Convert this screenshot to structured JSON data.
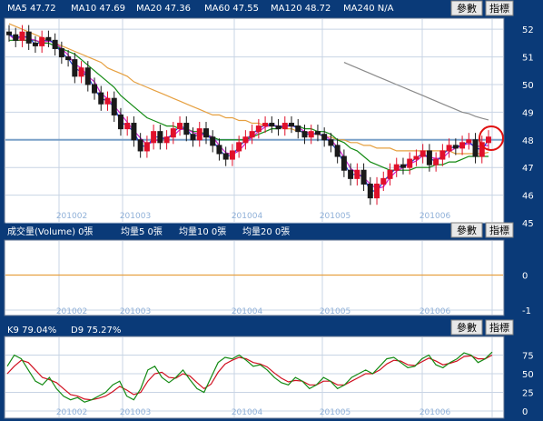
{
  "colors": {
    "background": "#0a3a78",
    "plot_bg": "#ffffff",
    "grid": "#c8d4e4",
    "border": "#5a6e8c",
    "up_candle": "#e0102a",
    "down_candle": "#1a1a1a",
    "ma5": "#1a3bd6",
    "ma10": "#d020d0",
    "ma20": "#138a13",
    "ma60": "#e6a040",
    "ma120": "#8a8a8a",
    "k_line": "#138a13",
    "d_line": "#d01020",
    "volume_zero_line": "#e6a040",
    "price_line": "#7aa0c8",
    "highlight_circle": "#e01010"
  },
  "buttons": {
    "query_label": "參數",
    "indicator_label": "指標"
  },
  "panels": {
    "price": {
      "header": [
        "MA5 47.72",
        "MA10 47.69",
        "MA20 47.36",
        "MA60 47.55",
        "MA120 48.72",
        "MA240 N/A"
      ]
    },
    "volume": {
      "header": [
        "成交量(Volume) 0張",
        "均量5 0張",
        "均量10 0張",
        "均量20 0張"
      ]
    },
    "kd": {
      "header": [
        "K9 79.04%",
        "D9 75.27%"
      ]
    }
  },
  "chart_data": [
    {
      "type": "line",
      "panel": "price",
      "x_labels": [
        "201002",
        "201003",
        "201004",
        "201005",
        "201006"
      ],
      "y_ticks": [
        "45",
        "46",
        "47",
        "48",
        "49",
        "50",
        "51",
        "52"
      ],
      "ylim": [
        45,
        52.4
      ],
      "grid": true,
      "current_price": 48,
      "series": [
        {
          "name": "MA5",
          "value": 47.72
        },
        {
          "name": "MA10",
          "value": 47.69
        },
        {
          "name": "MA20",
          "value": 47.36
        },
        {
          "name": "MA60",
          "value": 47.55
        },
        {
          "name": "MA120",
          "value": 48.72
        }
      ],
      "close": [
        51.8,
        51.6,
        51.9,
        51.5,
        51.4,
        51.7,
        51.6,
        51.3,
        51.0,
        50.9,
        50.3,
        50.6,
        50.0,
        49.7,
        49.3,
        49.5,
        48.9,
        48.4,
        48.6,
        48.0,
        47.6,
        47.9,
        48.3,
        47.9,
        48.1,
        48.4,
        48.6,
        48.2,
        48.0,
        48.4,
        48.1,
        47.8,
        47.5,
        47.3,
        47.6,
        47.9,
        48.1,
        48.3,
        48.5,
        48.6,
        48.5,
        48.4,
        48.6,
        48.5,
        48.3,
        48.1,
        48.3,
        48.2,
        48.0,
        47.8,
        47.4,
        46.9,
        46.6,
        46.9,
        46.4,
        45.9,
        46.4,
        46.6,
        46.9,
        47.1,
        47.0,
        47.3,
        47.4,
        47.6,
        47.1,
        47.3,
        47.6,
        47.8,
        47.7,
        47.9,
        48.0,
        47.4,
        47.9,
        48.1
      ],
      "ma20": [
        51.6,
        51.6,
        51.6,
        51.6,
        51.6,
        51.5,
        51.5,
        51.4,
        51.3,
        51.2,
        51.1,
        50.9,
        50.7,
        50.5,
        50.3,
        50.1,
        49.9,
        49.6,
        49.4,
        49.2,
        49.0,
        48.8,
        48.7,
        48.6,
        48.5,
        48.5,
        48.4,
        48.4,
        48.3,
        48.3,
        48.2,
        48.1,
        48.0,
        48.0,
        48.0,
        48.0,
        48.0,
        48.1,
        48.2,
        48.3,
        48.4,
        48.4,
        48.5,
        48.5,
        48.5,
        48.4,
        48.4,
        48.3,
        48.3,
        48.2,
        48.0,
        47.9,
        47.7,
        47.6,
        47.4,
        47.2,
        47.1,
        47.0,
        46.9,
        46.9,
        46.9,
        46.9,
        47.0,
        47.0,
        47.0,
        47.1,
        47.1,
        47.2,
        47.2,
        47.3,
        47.4,
        47.4,
        47.4,
        47.4
      ],
      "ma60": [
        52.2,
        52.1,
        52.0,
        51.9,
        51.8,
        51.7,
        51.6,
        51.5,
        51.4,
        51.3,
        51.2,
        51.1,
        51.0,
        50.9,
        50.8,
        50.6,
        50.5,
        50.4,
        50.3,
        50.1,
        50.0,
        49.9,
        49.8,
        49.7,
        49.6,
        49.5,
        49.4,
        49.3,
        49.2,
        49.1,
        49.0,
        48.9,
        48.9,
        48.8,
        48.8,
        48.7,
        48.7,
        48.6,
        48.6,
        48.5,
        48.5,
        48.5,
        48.4,
        48.4,
        48.3,
        48.3,
        48.2,
        48.2,
        48.1,
        48.1,
        48.0,
        48.0,
        47.9,
        47.9,
        47.8,
        47.8,
        47.7,
        47.7,
        47.7,
        47.6,
        47.6,
        47.6,
        47.6,
        47.6,
        47.6,
        47.6,
        47.6,
        47.6,
        47.5,
        47.5,
        47.5,
        47.5,
        47.5,
        47.55
      ],
      "ma120": [
        null,
        null,
        null,
        null,
        null,
        null,
        null,
        null,
        null,
        null,
        null,
        null,
        null,
        null,
        null,
        null,
        null,
        null,
        null,
        null,
        null,
        null,
        null,
        null,
        null,
        null,
        null,
        null,
        null,
        null,
        null,
        null,
        null,
        null,
        null,
        null,
        null,
        null,
        null,
        null,
        null,
        null,
        null,
        null,
        null,
        null,
        null,
        null,
        null,
        null,
        null,
        50.8,
        50.7,
        50.6,
        50.5,
        50.4,
        50.3,
        50.2,
        50.1,
        50.0,
        49.9,
        49.8,
        49.7,
        49.6,
        49.5,
        49.4,
        49.3,
        49.2,
        49.1,
        49.0,
        48.95,
        48.85,
        48.78,
        48.72
      ]
    },
    {
      "type": "line",
      "panel": "volume",
      "x_labels": [
        "201002",
        "201003",
        "201004",
        "201005",
        "201006"
      ],
      "y_ticks": [
        "0",
        "-1"
      ],
      "ylim": [
        -1,
        1
      ],
      "series": [
        {
          "name": "成交量(Volume)",
          "values": [
            0
          ]
        }
      ]
    },
    {
      "type": "line",
      "panel": "kd",
      "x_labels": [
        "201002",
        "201003",
        "201004",
        "201005",
        "201006"
      ],
      "y_ticks": [
        "75",
        "50",
        "25",
        "0"
      ],
      "ylim": [
        0,
        100
      ],
      "series": [
        {
          "name": "K9",
          "values": [
            60,
            75,
            70,
            55,
            40,
            35,
            45,
            30,
            20,
            15,
            18,
            12,
            15,
            20,
            25,
            35,
            40,
            20,
            15,
            30,
            55,
            60,
            45,
            38,
            45,
            55,
            42,
            30,
            25,
            45,
            65,
            72,
            70,
            75,
            68,
            60,
            62,
            55,
            45,
            38,
            35,
            45,
            40,
            30,
            35,
            45,
            40,
            30,
            35,
            45,
            50,
            55,
            50,
            60,
            70,
            72,
            65,
            58,
            60,
            70,
            75,
            62,
            58,
            65,
            70,
            78,
            75,
            65,
            70,
            79
          ]
        },
        {
          "name": "D9",
          "values": [
            50,
            60,
            68,
            65,
            55,
            45,
            42,
            38,
            30,
            22,
            20,
            16,
            15,
            17,
            20,
            26,
            33,
            28,
            22,
            25,
            40,
            50,
            52,
            45,
            44,
            50,
            47,
            38,
            30,
            36,
            52,
            63,
            68,
            72,
            70,
            65,
            63,
            59,
            51,
            44,
            39,
            41,
            40,
            35,
            35,
            40,
            40,
            35,
            35,
            40,
            45,
            50,
            50,
            55,
            63,
            68,
            67,
            62,
            61,
            66,
            71,
            67,
            62,
            64,
            67,
            73,
            74,
            70,
            70,
            75
          ]
        }
      ]
    }
  ]
}
